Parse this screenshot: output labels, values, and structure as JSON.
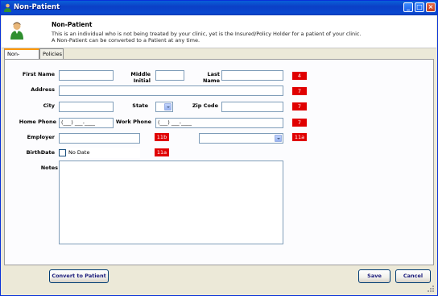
{
  "window": {
    "title": "Non-Patient"
  },
  "header": {
    "title": "Non-Patient",
    "line1": "This is an individual who is not being treated by your clinic, yet is the Insured/Policy Holder for a patient of your clinic.",
    "line2": "A Non-Patient can be converted to a Patient at any time."
  },
  "tabs": [
    {
      "label": "Non-Patient",
      "active": true
    },
    {
      "label": "Policies",
      "active": false
    }
  ],
  "form": {
    "first_name_label": "First Name",
    "first_name_value": "",
    "middle_initial_label": "Middle Initial",
    "middle_initial_value": "",
    "last_name_label": "Last Name",
    "last_name_value": "",
    "address_label": "Address",
    "address_value": "",
    "city_label": "City",
    "city_value": "",
    "state_label": "State",
    "state_value": "",
    "zip_label": "Zip Code",
    "zip_value": "",
    "home_phone_label": "Home Phone",
    "home_phone_value": "(___) ___-____",
    "work_phone_label": "Work Phone",
    "work_phone_value": "(___) ___-____",
    "employer_label": "Employer",
    "employer_value": "",
    "sex_label": "Sex",
    "sex_value": "",
    "birthdate_label": "BirthDate",
    "no_date_label": "No Date",
    "no_date_checked": false,
    "notes_label": "Notes",
    "notes_value": ""
  },
  "badges": {
    "last_name": "4",
    "address": "7",
    "zip": "7",
    "work_phone": "7",
    "employer": "11b",
    "sex": "11a",
    "birthdate": "11a"
  },
  "colors": {
    "badge": "#e00000",
    "titlebar": "#0a49d0",
    "panel": "#fcfcfe"
  },
  "buttons": {
    "convert": "Convert to Patient",
    "save": "Save",
    "cancel": "Cancel"
  }
}
